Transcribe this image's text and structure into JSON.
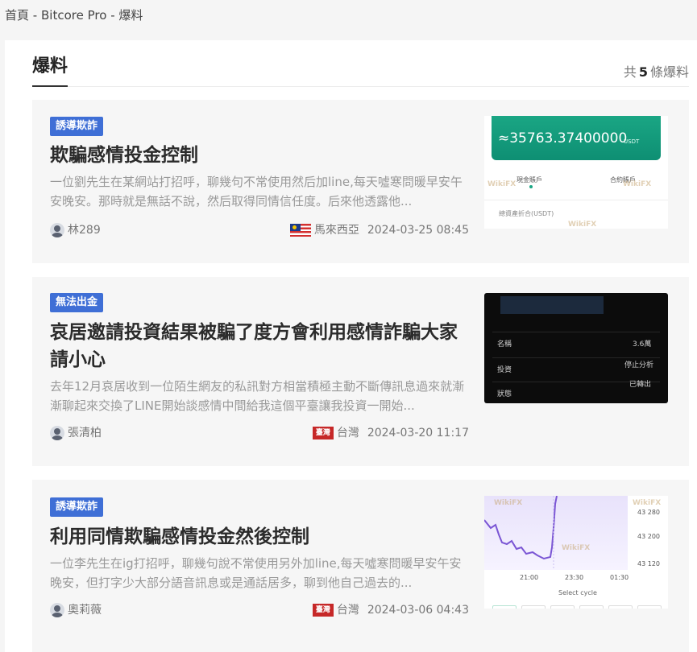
{
  "breadcrumb": {
    "home": "首頁",
    "sep1": "-",
    "broker": "Bitcore Pro",
    "sep2": "-",
    "current": "爆料"
  },
  "section": {
    "title": "爆料",
    "count_prefix": "共",
    "count": "5",
    "count_suffix": "條爆料"
  },
  "posts": [
    {
      "tag": "誘導欺詐",
      "title": "欺騙感情投金控制",
      "desc": "一位劉先生在某網站打招呼，聊幾句不常使用然后加line,每天噓寒問暖早安午安晚安。那時就是無話不說，然后取得同情信任度。后來他透露他...",
      "author": "林289",
      "region": "馬來西亞",
      "datetime": "2024-03-25 08:45",
      "thumb": {
        "amount": "≈35763.37400000",
        "unit": "USDT",
        "account_label": "現金賬戶",
        "contract_label": "合約賬戶",
        "assets_label": "總資產折合(USDT)",
        "watermark": "WikiFX"
      }
    },
    {
      "tag": "無法出金",
      "title": "哀居邀請投資結果被騙了度方會利用感情詐騙大家請小心",
      "desc": "去年12月哀居收到一位陌生網友的私訊對方相當積極主動不斷傳訊息過來就漸漸聊起來交換了LINE開始談感情中間給我這個平臺讓我投資一開始...",
      "author": "張清柏",
      "region": "台灣",
      "region_flag": "臺灣",
      "datetime": "2024-03-20 11:17",
      "thumb": {
        "row_labels": [
          "名稱",
          "投資",
          "狀態"
        ],
        "right_labels": [
          "3.6萬",
          "停止分析",
          "已轉出"
        ]
      }
    },
    {
      "tag": "誘導欺詐",
      "title": "利用同情欺騙感情投金然後控制",
      "desc": "一位李先生在ig打招呼，聊幾句說不常使用另外加line,每天噓寒問暖早安午安晚安，但打字少大部分語音訊息或是通話居多，聊到他自己過去的...",
      "author": "奧莉薇",
      "region": "台灣",
      "region_flag": "臺灣",
      "datetime": "2024-03-06 04:43",
      "thumb": {
        "y_ticks": [
          "43 280",
          "43 200",
          "43 120"
        ],
        "x_ticks": [
          "21:00",
          "23:30",
          "01:30"
        ],
        "select_label": "Select cycle",
        "watermark": "WikiFX"
      }
    }
  ],
  "colors": {
    "tag_bg": "#3f6fd6",
    "card_bg": "#f6f6f6",
    "title": "#2b2b2b",
    "desc": "#999999",
    "taiwan_flag": "#c62828"
  }
}
